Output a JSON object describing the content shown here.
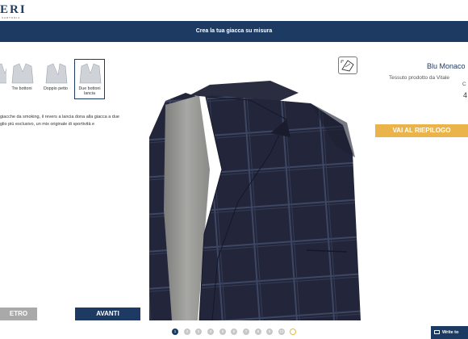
{
  "header": {
    "logo_text": "ERI",
    "logo_tag": "SARTORIA"
  },
  "banner": {
    "title": "Crea la tua giacca su misura"
  },
  "styles": [
    {
      "label": ""
    },
    {
      "label": "Tre bottoni"
    },
    {
      "label": "Doppio petto"
    },
    {
      "label": "Due bottoni lancia"
    }
  ],
  "description": {
    "line1": "giacche da smoking, il revers a lancia dona alla giacca a due",
    "line2": "glio più esclusivo, un mix originale di sportività e"
  },
  "nav": {
    "back_label": "ETRO",
    "next_label": "AVANTI"
  },
  "pager": {
    "pages": [
      "1",
      "2",
      "3",
      "4",
      "5",
      "6",
      "7",
      "8",
      "9",
      "10",
      ""
    ],
    "active": 0
  },
  "product": {
    "name": "Blu Monaco",
    "subtitle": "Tessuto prodotto da Vitale",
    "extra": "C",
    "price": "4"
  },
  "summary_button": {
    "label": "VAI AL RIEPILOGO"
  },
  "chat": {
    "label": "Write to"
  },
  "colors": {
    "navy": "#1d3a63",
    "gold": "#ebb44a",
    "grey_button": "#a9a9a9"
  }
}
